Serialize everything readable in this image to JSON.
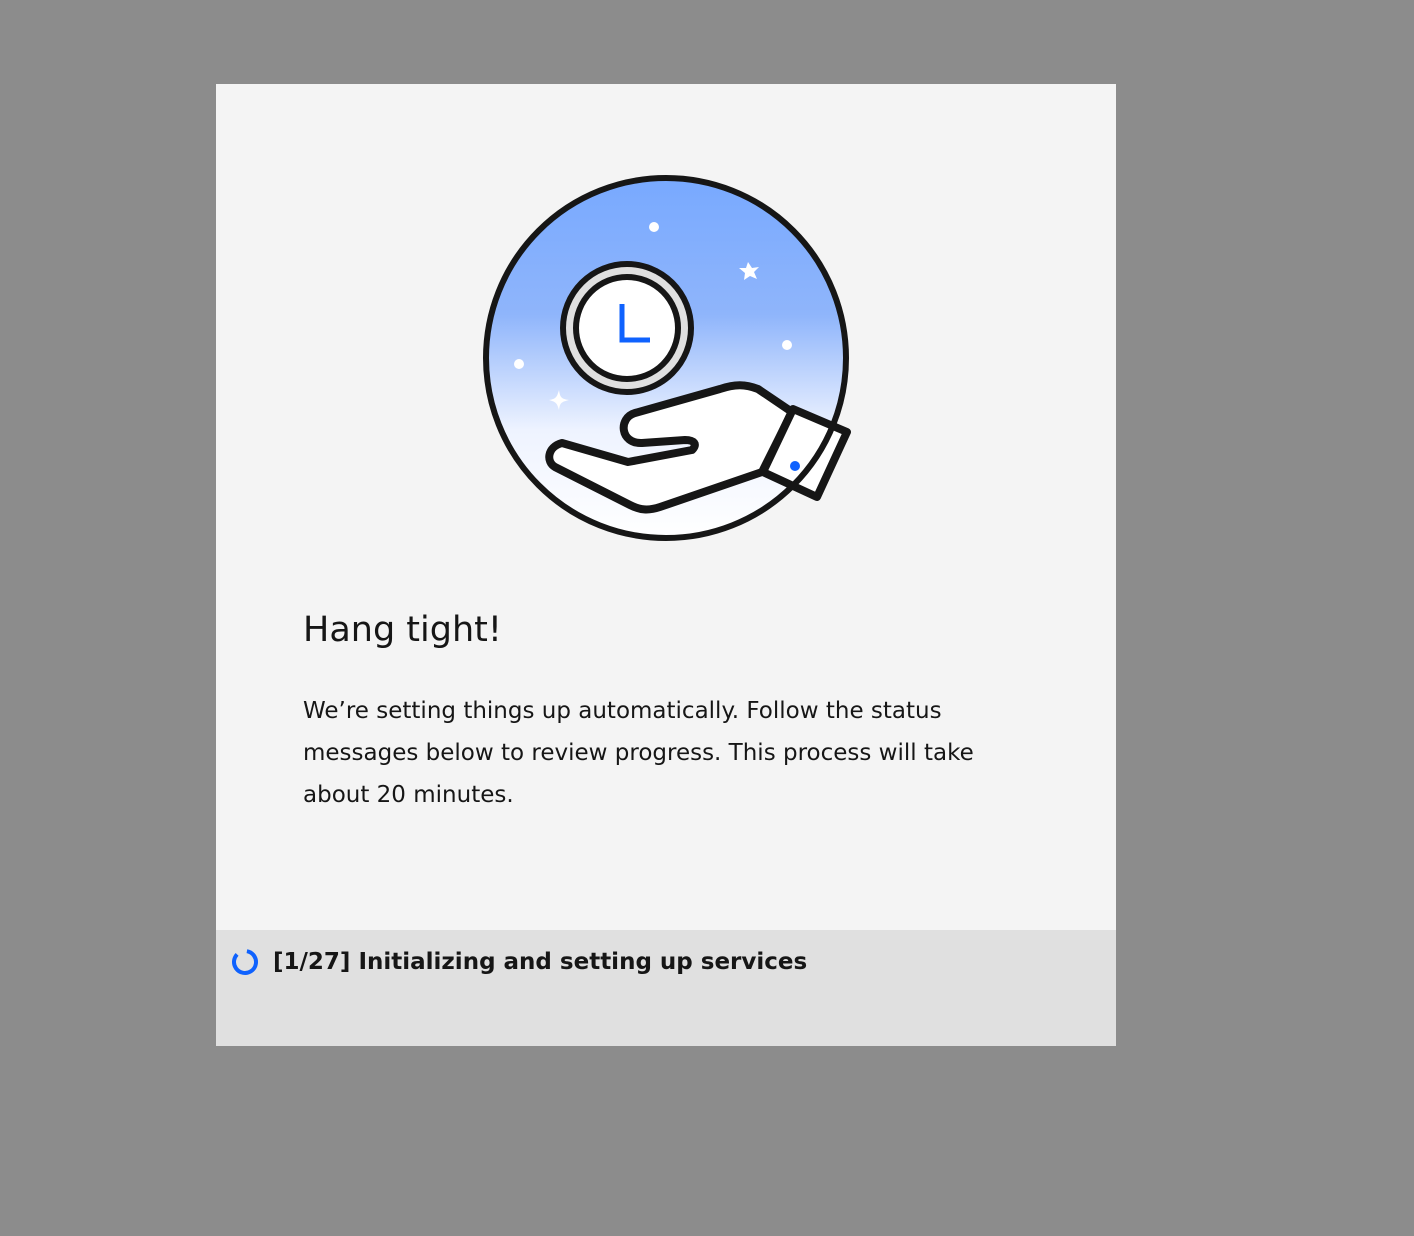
{
  "dialog": {
    "illustration_icon": "hand-holding-clock-illustration",
    "title": "Hang tight!",
    "message": "We’re setting things up automatically. Follow the status messages below to review progress. This process will take about 20 minutes."
  },
  "status": {
    "spinner_icon": "loading-spinner-icon",
    "text": "[1/27] Initializing and setting up services"
  },
  "colors": {
    "backdrop": "#8c8c8c",
    "dialog_background": "#f4f4f4",
    "status_background": "#e0e0e0",
    "accent": "#0f62fe",
    "text": "#161616"
  }
}
